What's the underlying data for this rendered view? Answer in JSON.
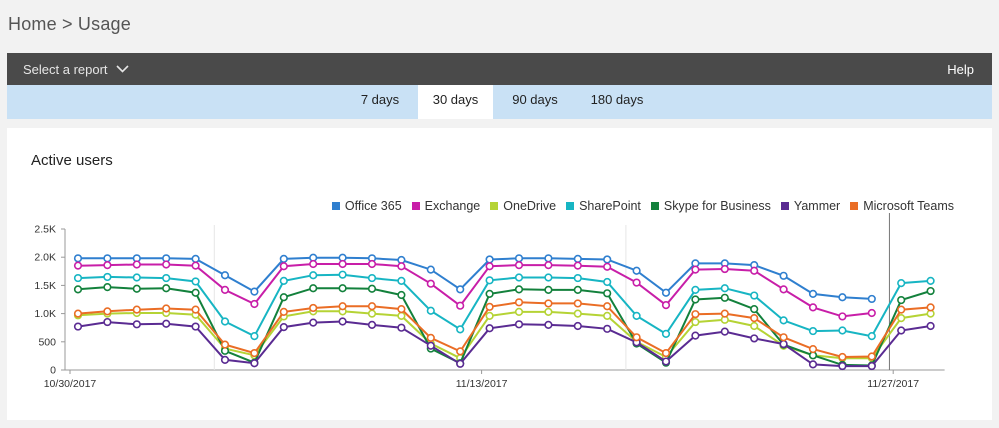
{
  "breadcrumb": "Home > Usage",
  "topbar": {
    "select_report": "Select a report",
    "help": "Help"
  },
  "tabs": [
    {
      "label": "7 days",
      "active": false
    },
    {
      "label": "30 days",
      "active": true
    },
    {
      "label": "90 days",
      "active": false
    },
    {
      "label": "180 days",
      "active": false
    }
  ],
  "card": {
    "title": "Active users"
  },
  "chart_data": {
    "type": "line",
    "title": "Active users",
    "xlabel": "",
    "ylabel": "",
    "ylim": [
      0,
      2500
    ],
    "y_ticks": [
      "0",
      "500",
      "1.0K",
      "1.5K",
      "2.0K",
      "2.5K"
    ],
    "x_tick_labels": [
      "10/30/2017",
      "11/13/2017",
      "11/27/2017"
    ],
    "legend_position": "top-right",
    "grid": false,
    "series": [
      {
        "name": "Office 365",
        "color": "#2f7fcf",
        "values": [
          1980,
          1980,
          1980,
          1980,
          1970,
          1680,
          1390,
          1970,
          1990,
          1990,
          1980,
          1950,
          1780,
          1430,
          1960,
          1980,
          1980,
          1970,
          1960,
          1760,
          1370,
          1890,
          1890,
          1860,
          1670,
          1350,
          1290,
          1260,
          null,
          null
        ]
      },
      {
        "name": "Exchange",
        "color": "#c81ea8",
        "values": [
          1850,
          1860,
          1870,
          1870,
          1850,
          1420,
          1170,
          1840,
          1880,
          1880,
          1880,
          1840,
          1530,
          1140,
          1840,
          1860,
          1860,
          1850,
          1830,
          1550,
          1150,
          1780,
          1790,
          1760,
          1430,
          1110,
          950,
          1010,
          null,
          null
        ]
      },
      {
        "name": "OneDrive",
        "color": "#b5d335",
        "values": [
          970,
          1000,
          1010,
          1010,
          980,
          380,
          260,
          950,
          1040,
          1040,
          1000,
          960,
          470,
          210,
          960,
          1030,
          1030,
          1000,
          960,
          500,
          230,
          850,
          890,
          780,
          430,
          260,
          210,
          210,
          920,
          1000
        ]
      },
      {
        "name": "SharePoint",
        "color": "#17b5c3",
        "values": [
          1630,
          1650,
          1640,
          1630,
          1570,
          860,
          600,
          1580,
          1680,
          1690,
          1630,
          1580,
          1050,
          720,
          1590,
          1640,
          1640,
          1630,
          1560,
          960,
          640,
          1420,
          1450,
          1320,
          880,
          690,
          700,
          600,
          1540,
          1580
        ]
      },
      {
        "name": "Skype for Business",
        "color": "#13813c",
        "values": [
          1430,
          1470,
          1440,
          1450,
          1370,
          340,
          130,
          1290,
          1450,
          1450,
          1440,
          1330,
          380,
          120,
          1350,
          1430,
          1420,
          1420,
          1360,
          470,
          130,
          1250,
          1280,
          1080,
          450,
          260,
          90,
          80,
          1240,
          1400
        ]
      },
      {
        "name": "Yammer",
        "color": "#5a2b92",
        "values": [
          770,
          850,
          810,
          820,
          770,
          180,
          120,
          760,
          840,
          860,
          800,
          750,
          430,
          110,
          740,
          810,
          800,
          780,
          730,
          490,
          150,
          610,
          680,
          560,
          460,
          100,
          70,
          70,
          700,
          780
        ]
      },
      {
        "name": "Microsoft Teams",
        "color": "#ea6d25",
        "values": [
          1000,
          1040,
          1070,
          1090,
          1070,
          450,
          300,
          1030,
          1100,
          1130,
          1130,
          1080,
          570,
          330,
          1120,
          1200,
          1180,
          1180,
          1130,
          580,
          300,
          990,
          1000,
          920,
          580,
          370,
          230,
          240,
          1070,
          1110
        ]
      }
    ]
  }
}
